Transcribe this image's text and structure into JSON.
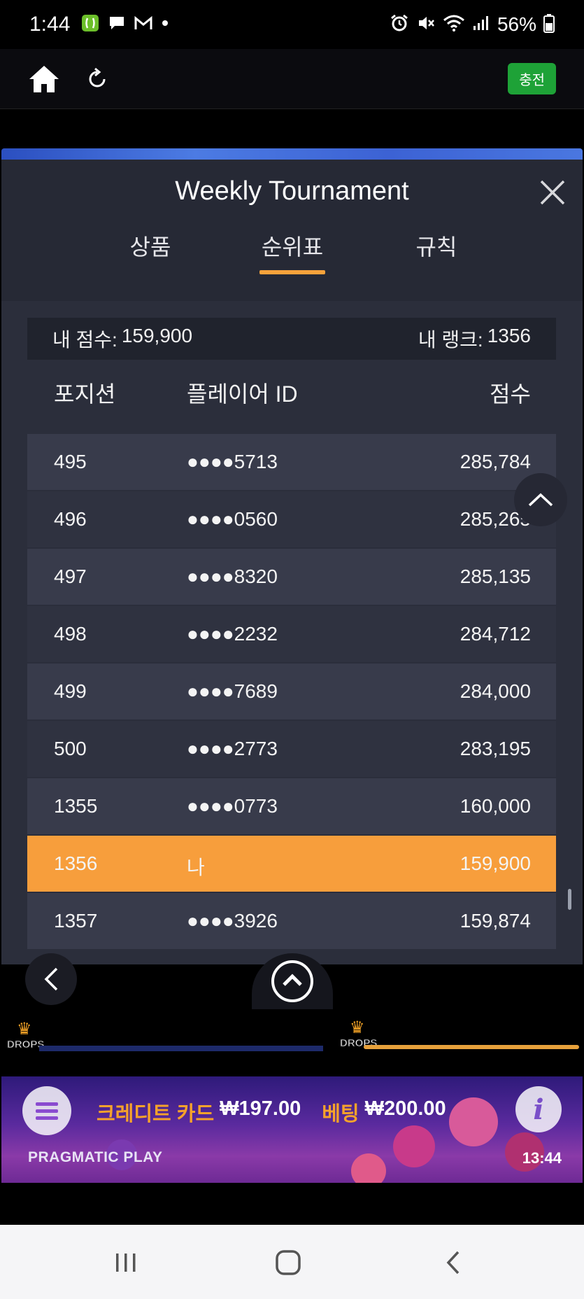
{
  "status_bar": {
    "time": "1:44",
    "battery_percent": "56%"
  },
  "toolbar": {
    "charge_label": "충전"
  },
  "modal": {
    "title": "Weekly Tournament",
    "tabs": [
      {
        "label": "상품"
      },
      {
        "label": "순위표"
      },
      {
        "label": "규칙"
      }
    ],
    "active_tab": "순위표",
    "summary": {
      "my_score_label": "내 점수:",
      "my_score_value": "159,900",
      "my_rank_label": "내 랭크:",
      "my_rank_value": "1356"
    },
    "columns": {
      "position": "포지션",
      "player_id": "플레이어 ID",
      "score": "점수"
    },
    "rows": [
      {
        "position": "495",
        "player_id": "●●●●5713",
        "score": "285,784"
      },
      {
        "position": "496",
        "player_id": "●●●●0560",
        "score": "285,265"
      },
      {
        "position": "497",
        "player_id": "●●●●8320",
        "score": "285,135"
      },
      {
        "position": "498",
        "player_id": "●●●●2232",
        "score": "284,712"
      },
      {
        "position": "499",
        "player_id": "●●●●7689",
        "score": "284,000"
      },
      {
        "position": "500",
        "player_id": "●●●●2773",
        "score": "283,195"
      },
      {
        "position": "1355",
        "player_id": "●●●●0773",
        "score": "160,000"
      },
      {
        "position": "1356",
        "player_id": "나",
        "score": "159,900"
      },
      {
        "position": "1357",
        "player_id": "●●●●3926",
        "score": "159,874"
      }
    ],
    "highlight_color": "#f79e3c"
  },
  "game": {
    "drops_label": "DROPS",
    "credit_label": "크레디트 카드",
    "credit_value": "₩197.00",
    "bet_label": "베팅",
    "bet_value": "₩200.00",
    "provider": "PRAGMATIC PLAY",
    "clock": "13:44"
  },
  "colors": {
    "accent": "#f7a23b",
    "charge_green": "#1ea237",
    "panel": "#2b2e3b"
  }
}
